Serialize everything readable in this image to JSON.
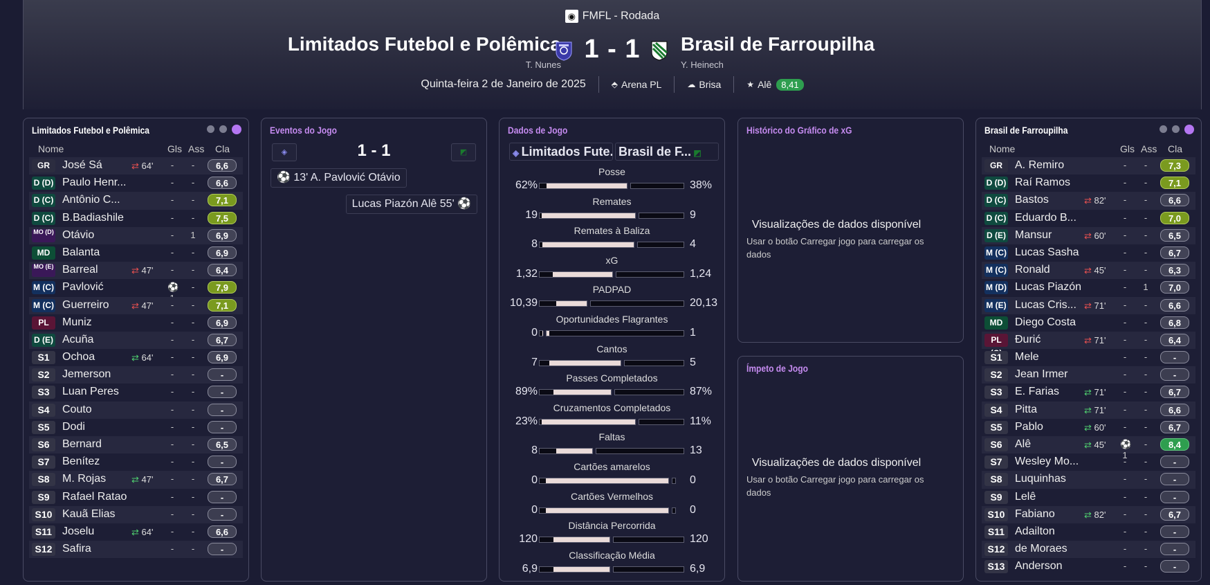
{
  "match": {
    "competition": "FMFL - Rodada",
    "home_team": "Limitados Futebol e Polêmica",
    "away_team": "Brasil de Farroupilha",
    "home_manager": "T. Nunes",
    "away_manager": "Y. Heinech",
    "score": "1 - 1",
    "date": "Quinta-feira 2 de Janeiro de 2025",
    "stadium": "Arena PL",
    "weather": "Brisa",
    "pom_name": "Alê",
    "pom_rating": "8,41"
  },
  "home_panel": {
    "title": "Limitados Futebol e Polêmica",
    "col_name": "Nome",
    "col_gls": "Gls",
    "col_ass": "Ass",
    "col_cla": "Cla"
  },
  "away_panel": {
    "title": "Brasil de Farroupilha",
    "col_name": "Nome",
    "col_gls": "Gls",
    "col_ass": "Ass",
    "col_cla": "Cla"
  },
  "home_players": [
    {
      "pos": "GR",
      "name": "José Sá",
      "sub": "out",
      "min": "64'",
      "gls": "-",
      "ass": "-",
      "rating": "6,6",
      "rc": ""
    },
    {
      "pos": "D (D)",
      "name": "Paulo Henr...",
      "sub": "",
      "min": "",
      "gls": "-",
      "ass": "-",
      "rating": "6,6",
      "rc": ""
    },
    {
      "pos": "D (C)",
      "name": "Antônio C...",
      "sub": "",
      "min": "",
      "gls": "-",
      "ass": "-",
      "rating": "7,1",
      "rc": "y"
    },
    {
      "pos": "D (C)",
      "name": "B.Badiashile",
      "sub": "",
      "min": "",
      "gls": "-",
      "ass": "-",
      "rating": "7,5",
      "rc": "y"
    },
    {
      "pos": "MO (D)",
      "name": "Otávio",
      "sub": "",
      "min": "",
      "gls": "-",
      "ass": "1",
      "rating": "6,9",
      "rc": ""
    },
    {
      "pos": "MD",
      "name": "Balanta",
      "sub": "",
      "min": "",
      "gls": "-",
      "ass": "-",
      "rating": "6,9",
      "rc": ""
    },
    {
      "pos": "MO (E)",
      "name": "Barreal",
      "sub": "out",
      "min": "47'",
      "gls": "-",
      "ass": "-",
      "rating": "6,4",
      "rc": ""
    },
    {
      "pos": "M (C)",
      "name": "Pavlović",
      "sub": "",
      "min": "",
      "gls": "⚽1",
      "ass": "-",
      "rating": "7,9",
      "rc": "y"
    },
    {
      "pos": "M (C)",
      "name": "Guerreiro",
      "sub": "out",
      "min": "47'",
      "gls": "-",
      "ass": "-",
      "rating": "7,1",
      "rc": "y"
    },
    {
      "pos": "PL (C)",
      "name": "Muniz",
      "sub": "",
      "min": "",
      "gls": "-",
      "ass": "-",
      "rating": "6,9",
      "rc": ""
    },
    {
      "pos": "D (E)",
      "name": "Acuña",
      "sub": "",
      "min": "",
      "gls": "-",
      "ass": "-",
      "rating": "6,7",
      "rc": ""
    },
    {
      "pos": "S1",
      "name": "Ochoa",
      "sub": "in",
      "min": "64'",
      "gls": "-",
      "ass": "-",
      "rating": "6,9",
      "rc": ""
    },
    {
      "pos": "S2",
      "name": "Jemerson",
      "sub": "",
      "min": "",
      "gls": "-",
      "ass": "-",
      "rating": "-",
      "rc": "d"
    },
    {
      "pos": "S3",
      "name": "Luan Peres",
      "sub": "",
      "min": "",
      "gls": "-",
      "ass": "-",
      "rating": "-",
      "rc": "d"
    },
    {
      "pos": "S4",
      "name": "Couto",
      "sub": "",
      "min": "",
      "gls": "-",
      "ass": "-",
      "rating": "-",
      "rc": "d"
    },
    {
      "pos": "S5",
      "name": "Dodi",
      "sub": "",
      "min": "",
      "gls": "-",
      "ass": "-",
      "rating": "-",
      "rc": "d"
    },
    {
      "pos": "S6",
      "name": "Bernard",
      "sub": "",
      "min": "",
      "gls": "-",
      "ass": "-",
      "rating": "6,5",
      "rc": ""
    },
    {
      "pos": "S7",
      "name": "Benítez",
      "sub": "",
      "min": "",
      "gls": "-",
      "ass": "-",
      "rating": "-",
      "rc": "d"
    },
    {
      "pos": "S8",
      "name": "M. Rojas",
      "sub": "in",
      "min": "47'",
      "gls": "-",
      "ass": "-",
      "rating": "6,7",
      "rc": ""
    },
    {
      "pos": "S9",
      "name": "Rafael Ratao",
      "sub": "",
      "min": "",
      "gls": "-",
      "ass": "-",
      "rating": "-",
      "rc": "d"
    },
    {
      "pos": "S10",
      "name": "Kauã Elias",
      "sub": "",
      "min": "",
      "gls": "-",
      "ass": "-",
      "rating": "-",
      "rc": "d"
    },
    {
      "pos": "S11",
      "name": "Joselu",
      "sub": "in",
      "min": "64'",
      "gls": "-",
      "ass": "-",
      "rating": "6,6",
      "rc": ""
    },
    {
      "pos": "S12",
      "name": "Safira",
      "sub": "",
      "min": "",
      "gls": "-",
      "ass": "-",
      "rating": "-",
      "rc": "d"
    }
  ],
  "away_players": [
    {
      "pos": "GR",
      "name": "A. Remiro",
      "sub": "",
      "min": "",
      "gls": "-",
      "ass": "-",
      "rating": "7,3",
      "rc": "y"
    },
    {
      "pos": "D (D)",
      "name": "Raí Ramos",
      "sub": "",
      "min": "",
      "gls": "-",
      "ass": "-",
      "rating": "7,1",
      "rc": "y"
    },
    {
      "pos": "D (C)",
      "name": "Bastos",
      "sub": "out",
      "min": "82'",
      "gls": "-",
      "ass": "-",
      "rating": "6,6",
      "rc": ""
    },
    {
      "pos": "D (C)",
      "name": "Eduardo B...",
      "sub": "",
      "min": "",
      "gls": "-",
      "ass": "-",
      "rating": "7,0",
      "rc": "y"
    },
    {
      "pos": "D (E)",
      "name": "Mansur",
      "sub": "out",
      "min": "60'",
      "gls": "-",
      "ass": "-",
      "rating": "6,5",
      "rc": ""
    },
    {
      "pos": "M (C)",
      "name": "Lucas Sasha",
      "sub": "",
      "min": "",
      "gls": "-",
      "ass": "-",
      "rating": "6,7",
      "rc": ""
    },
    {
      "pos": "M (C)",
      "name": "Ronald",
      "sub": "out",
      "min": "45'",
      "gls": "-",
      "ass": "-",
      "rating": "6,3",
      "rc": ""
    },
    {
      "pos": "M (D)",
      "name": "Lucas Piazón",
      "sub": "",
      "min": "",
      "gls": "-",
      "ass": "1",
      "rating": "7,0",
      "rc": ""
    },
    {
      "pos": "M (E)",
      "name": "Lucas Cris...",
      "sub": "out",
      "min": "71'",
      "gls": "-",
      "ass": "-",
      "rating": "6,6",
      "rc": ""
    },
    {
      "pos": "MD",
      "name": "Diego Costa",
      "sub": "",
      "min": "",
      "gls": "-",
      "ass": "-",
      "rating": "6,8",
      "rc": ""
    },
    {
      "pos": "PL (C)",
      "name": "Đurić",
      "sub": "out",
      "min": "71'",
      "gls": "-",
      "ass": "-",
      "rating": "6,4",
      "rc": ""
    },
    {
      "pos": "S1",
      "name": "Mele",
      "sub": "",
      "min": "",
      "gls": "-",
      "ass": "-",
      "rating": "-",
      "rc": "d"
    },
    {
      "pos": "S2",
      "name": "Jean Irmer",
      "sub": "",
      "min": "",
      "gls": "-",
      "ass": "-",
      "rating": "-",
      "rc": "d"
    },
    {
      "pos": "S3",
      "name": "E. Farias",
      "sub": "in",
      "min": "71'",
      "gls": "-",
      "ass": "-",
      "rating": "6,7",
      "rc": ""
    },
    {
      "pos": "S4",
      "name": "Pitta",
      "sub": "in",
      "min": "71'",
      "gls": "-",
      "ass": "-",
      "rating": "6,6",
      "rc": ""
    },
    {
      "pos": "S5",
      "name": "Pablo",
      "sub": "in",
      "min": "60'",
      "gls": "-",
      "ass": "-",
      "rating": "6,7",
      "rc": ""
    },
    {
      "pos": "S6",
      "name": "Alê",
      "sub": "in",
      "min": "45'",
      "gls": "⚽1",
      "ass": "-",
      "rating": "8,4",
      "rc": "g"
    },
    {
      "pos": "S7",
      "name": "Wesley Mo...",
      "sub": "",
      "min": "",
      "gls": "-",
      "ass": "-",
      "rating": "-",
      "rc": "d"
    },
    {
      "pos": "S8",
      "name": "Luquinhas",
      "sub": "",
      "min": "",
      "gls": "-",
      "ass": "-",
      "rating": "-",
      "rc": "d"
    },
    {
      "pos": "S9",
      "name": "Lelê",
      "sub": "",
      "min": "",
      "gls": "-",
      "ass": "-",
      "rating": "-",
      "rc": "d"
    },
    {
      "pos": "S10",
      "name": "Fabiano",
      "sub": "in",
      "min": "82'",
      "gls": "-",
      "ass": "-",
      "rating": "6,7",
      "rc": ""
    },
    {
      "pos": "S11",
      "name": "Adailton",
      "sub": "",
      "min": "",
      "gls": "-",
      "ass": "-",
      "rating": "-",
      "rc": "d"
    },
    {
      "pos": "S12",
      "name": "de Moraes",
      "sub": "",
      "min": "",
      "gls": "-",
      "ass": "-",
      "rating": "-",
      "rc": "d"
    },
    {
      "pos": "S13",
      "name": "Anderson",
      "sub": "",
      "min": "",
      "gls": "-",
      "ass": "-",
      "rating": "-",
      "rc": "d"
    }
  ],
  "events_panel": {
    "title": "Eventos do Jogo",
    "score": "1 - 1",
    "events": [
      {
        "side": "home",
        "text": "13' A. Pavlović Otávio"
      },
      {
        "side": "away",
        "text": "Lucas Piazón Alê 55'"
      }
    ]
  },
  "stats_panel": {
    "title": "Dados de Jogo",
    "home_label": "Limitados Fute...",
    "away_label": "Brasil de F...",
    "stats": [
      {
        "label": "Posse",
        "home": "62%",
        "away": "38%",
        "hf": 0.62,
        "af": 0.38
      },
      {
        "label": "Remates",
        "home": "19",
        "away": "9",
        "hf": 0.68,
        "af": 0.32
      },
      {
        "label": "Remates à Baliza",
        "home": "8",
        "away": "4",
        "hf": 0.67,
        "af": 0.33
      },
      {
        "label": "xG",
        "home": "1,32",
        "away": "1,24",
        "hf": 0.52,
        "af": 0.48
      },
      {
        "label": "PADPAD",
        "home": "10,39",
        "away": "20,13",
        "hf": 0.34,
        "af": 0.66
      },
      {
        "label": "Oportunidades Flagrantes",
        "home": "0",
        "away": "1",
        "hf": 0.0,
        "af": 1.0
      },
      {
        "label": "Cantos",
        "home": "7",
        "away": "5",
        "hf": 0.58,
        "af": 0.42
      },
      {
        "label": "Passes Completados",
        "home": "89%",
        "away": "87%",
        "hf": 0.51,
        "af": 0.49
      },
      {
        "label": "Cruzamentos Completados",
        "home": "23%",
        "away": "11%",
        "hf": 0.68,
        "af": 0.32
      },
      {
        "label": "Faltas",
        "home": "8",
        "away": "13",
        "hf": 0.38,
        "af": 0.62
      },
      {
        "label": "Cartões amarelos",
        "home": "0",
        "away": "0",
        "hf": 1.0,
        "af": 1.0
      },
      {
        "label": "Cartões Vermelhos",
        "home": "0",
        "away": "0",
        "hf": 1.0,
        "af": 1.0
      },
      {
        "label": "Distância Percorrida",
        "home": "120",
        "away": "120",
        "hf": 0.5,
        "af": 0.5
      },
      {
        "label": "Classificação Média",
        "home": "6,9",
        "away": "6,9",
        "hf": 0.5,
        "af": 0.5
      }
    ]
  },
  "xg_panel": {
    "title": "Histórico do Gráfico de xG",
    "nodata_title": "Visualizações de dados disponível",
    "nodata_sub": "Usar o botão Carregar jogo para carregar os dados"
  },
  "momentum_panel": {
    "title": "Ímpeto de Jogo",
    "nodata_title": "Visualizações de dados disponível",
    "nodata_sub": "Usar o botão Carregar jogo para carregar os dados"
  }
}
